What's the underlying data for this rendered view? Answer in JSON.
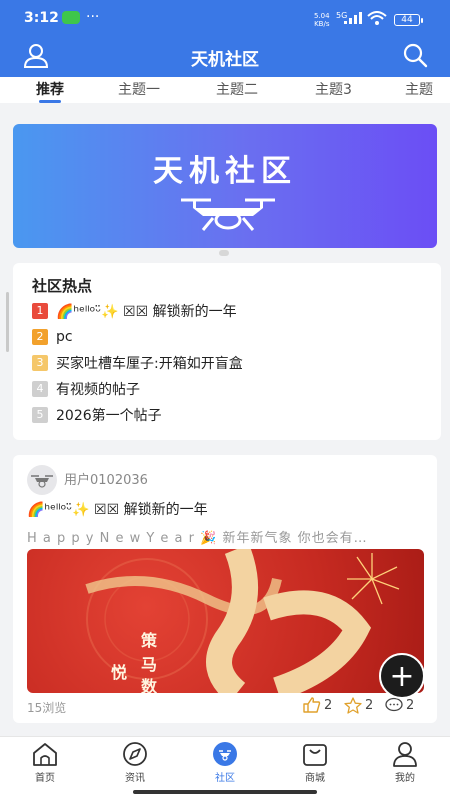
{
  "status_bar": {
    "time": "3:12",
    "dots": "···",
    "speed_value": "5.04",
    "speed_unit": "KB/s",
    "network": "5G",
    "battery": "44"
  },
  "header": {
    "title": "天机社区",
    "user_icon": "user-icon",
    "search_icon": "search-icon",
    "bg_color": "#3a78e6"
  },
  "tabs": [
    {
      "label": "推荐",
      "active": true
    },
    {
      "label": "主题一",
      "active": false
    },
    {
      "label": "主题二",
      "active": false
    },
    {
      "label": "主题3",
      "active": false
    },
    {
      "label": "主题",
      "active": false
    }
  ],
  "banner": {
    "text": "天机社区",
    "icon": "drone-icon"
  },
  "hot_topics": {
    "title": "社区热点",
    "items": [
      {
        "rank": "1",
        "color": "#e94b3c",
        "text": "🌈ʰᵉˡˡᵒᵕ̈✨ ☒☒ 解锁新的一年"
      },
      {
        "rank": "2",
        "color": "#f2a12c",
        "text": "pc"
      },
      {
        "rank": "3",
        "color": "#f5c76a",
        "text": "买家吐槽车厘子:开箱如开盲盒"
      },
      {
        "rank": "4",
        "color": "#cfcfcf",
        "text": "有视频的帖子"
      },
      {
        "rank": "5",
        "color": "#cfcfcf",
        "text": "2026第一个帖子"
      }
    ]
  },
  "post": {
    "username": "用户0102036",
    "title": "🌈ʰᵉˡˡᵒᵕ̈✨ ☒☒ 解锁新的一年",
    "excerpt": "H a p p y  N e w  Y e a r 🎉 新年新气象 你也会有…",
    "image_text_1": "策",
    "image_text_2": "马",
    "image_text_3": "悦",
    "image_text_4": "数",
    "views": "15浏览",
    "likes": "2",
    "favorites": "2",
    "comments": "2"
  },
  "fab": {
    "label": "+"
  },
  "bottom_nav": [
    {
      "label": "首页",
      "icon": "home-icon",
      "active": false
    },
    {
      "label": "资讯",
      "icon": "compass-icon",
      "active": false
    },
    {
      "label": "社区",
      "icon": "community-icon",
      "active": true
    },
    {
      "label": "商城",
      "icon": "shop-icon",
      "active": false
    },
    {
      "label": "我的",
      "icon": "profile-icon",
      "active": false
    }
  ]
}
